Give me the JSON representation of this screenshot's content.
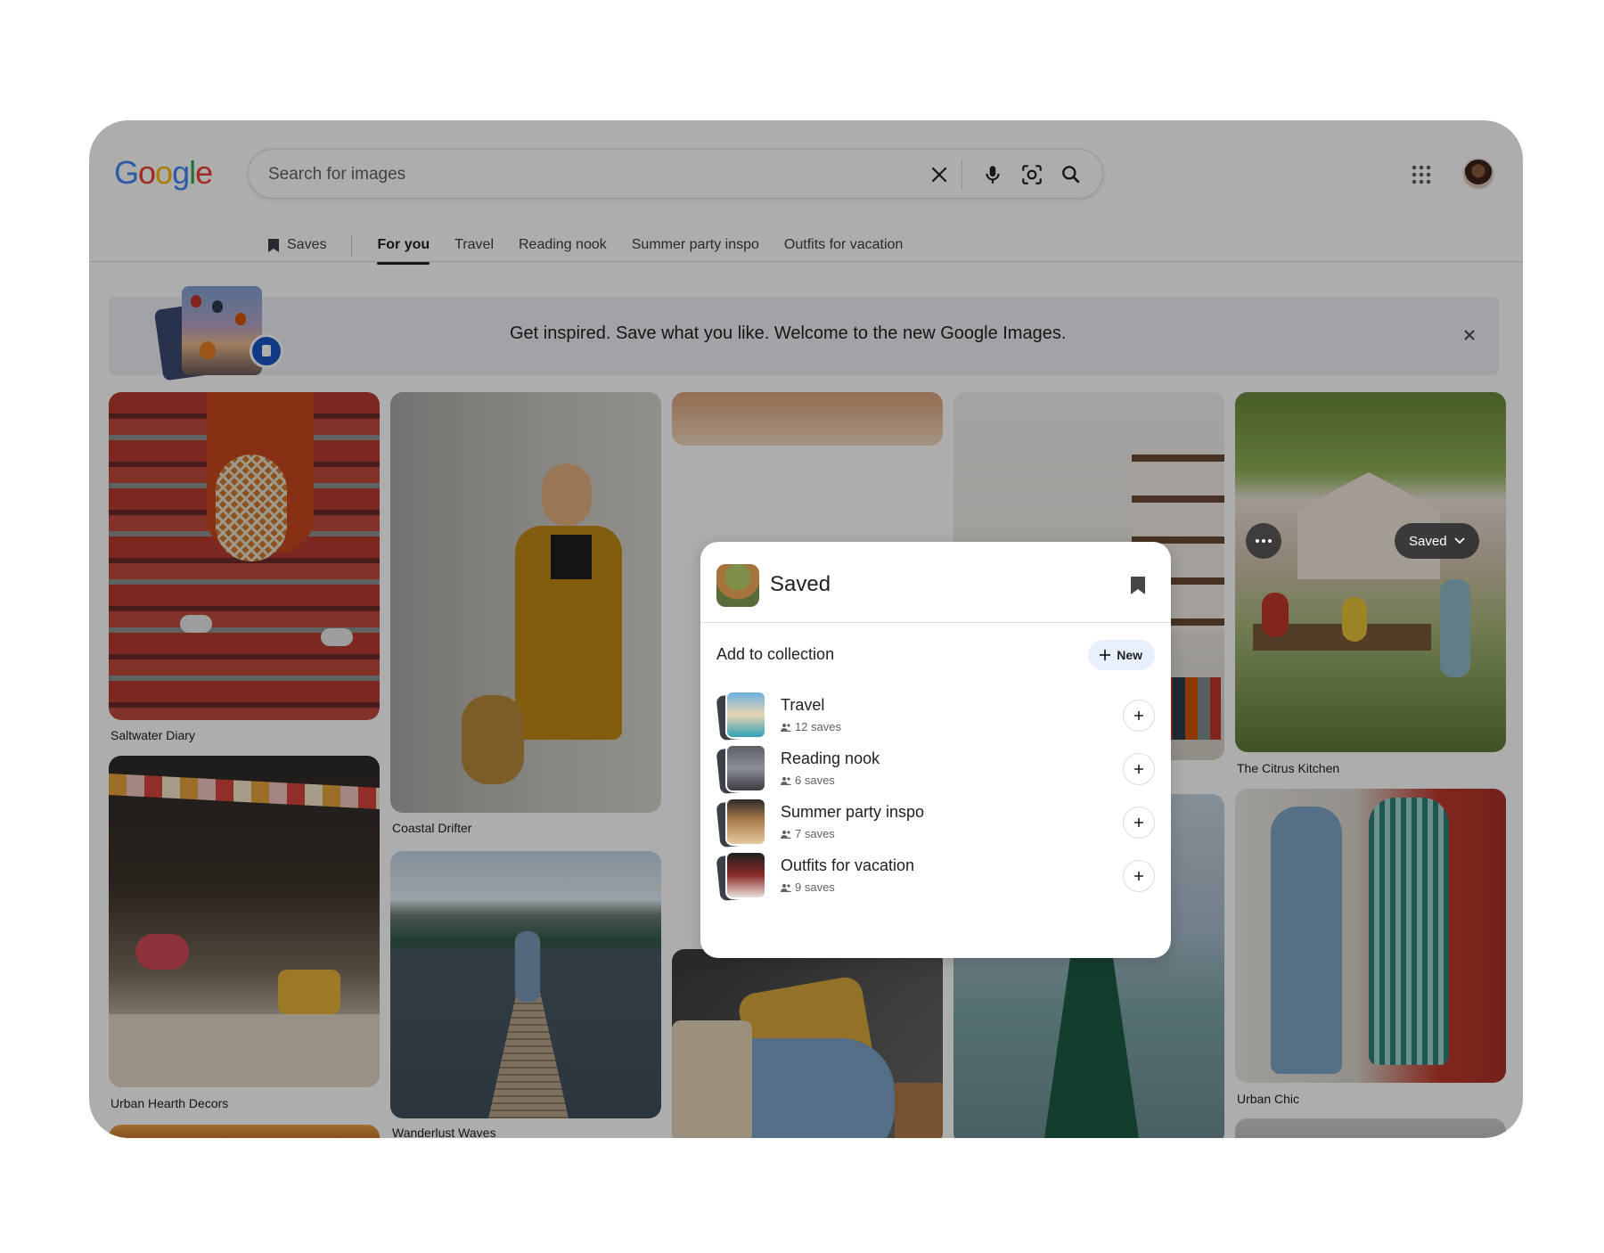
{
  "header": {
    "logo_letters": [
      "G",
      "o",
      "o",
      "g",
      "l",
      "e"
    ],
    "logo_colors": [
      "#4285F4",
      "#EA4335",
      "#FBBC05",
      "#4285F4",
      "#34A853",
      "#EA4335"
    ],
    "search_placeholder": "Search for images",
    "icons": [
      "close-icon",
      "mic-icon",
      "lens-icon",
      "search-icon",
      "apps-grid-icon"
    ]
  },
  "tabs": {
    "saves": "Saves",
    "items": [
      "For you",
      "Travel",
      "Reading nook",
      "Summer party inspo",
      "Outfits for vacation"
    ],
    "active": "For you"
  },
  "banner": {
    "text": "Get inspired. Save what you like. Welcome to the new Google Images."
  },
  "grid": {
    "captions": {
      "c1": "Saltwater Diary",
      "c2": "Urban Hearth Decors",
      "c3": "Coastal Drifter",
      "c4": "Wanderlust Waves",
      "c5": "The Citrus Kitchen",
      "c6": "Urban Chic"
    },
    "saved_button": "Saved"
  },
  "popup": {
    "title": "Saved",
    "subtitle": "Add to collection",
    "new_label": "New",
    "collections": [
      {
        "name": "Travel",
        "count": "12 saves",
        "color": "#4aa3c8"
      },
      {
        "name": "Reading nook",
        "count": "6 saves",
        "color": "#6b6e76"
      },
      {
        "name": "Summer party inspo",
        "count": "7 saves",
        "color": "#a77b4a"
      },
      {
        "name": "Outfits for vacation",
        "count": "9 saves",
        "color": "#7a3c3c"
      }
    ]
  },
  "colors": {
    "accent": "#1a73e8",
    "new_button_bg": "#e8f0fe"
  }
}
